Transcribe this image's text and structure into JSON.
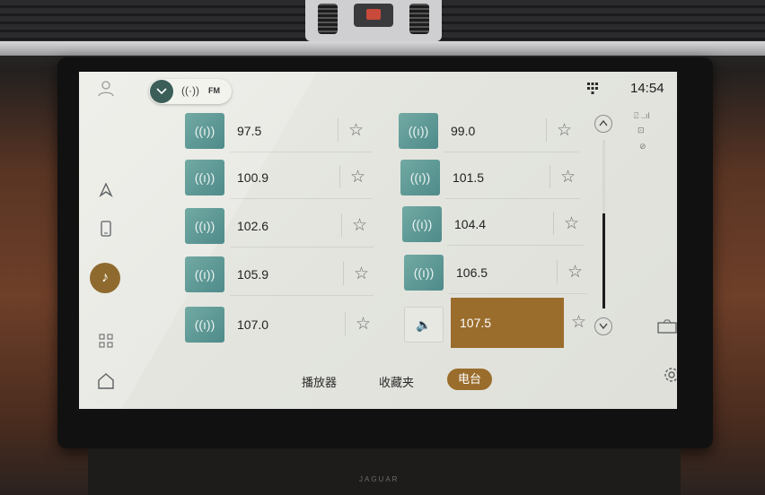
{
  "status": {
    "time": "14:54"
  },
  "source_selector": {
    "band": "FM"
  },
  "nav": {
    "items": [
      {
        "name": "user-icon",
        "glyph": "👤"
      },
      {
        "name": "navigation-icon",
        "glyph": "▲"
      },
      {
        "name": "phone-icon",
        "glyph": "▯"
      },
      {
        "name": "music-icon",
        "glyph": "♪"
      },
      {
        "name": "apps-grid-icon",
        "glyph": "▦"
      },
      {
        "name": "home-icon",
        "glyph": "⌂"
      }
    ]
  },
  "stations": [
    {
      "freq": "97.5",
      "favorite": false
    },
    {
      "freq": "99.0",
      "favorite": false
    },
    {
      "freq": "100.9",
      "favorite": false
    },
    {
      "freq": "101.5",
      "favorite": false
    },
    {
      "freq": "102.6",
      "favorite": false
    },
    {
      "freq": "104.4",
      "favorite": false
    },
    {
      "freq": "105.9",
      "favorite": false
    },
    {
      "freq": "106.5",
      "favorite": false
    },
    {
      "freq": "107.0",
      "favorite": false
    },
    {
      "freq": "107.5",
      "favorite": false,
      "playing": true
    }
  ],
  "tabs": {
    "player": "播放器",
    "favorites": "收藏夹",
    "radio": "电台"
  },
  "colors": {
    "accent": "#9a6d2c",
    "thumb": "#5f9a96",
    "pill_dark": "#3b5e58"
  }
}
